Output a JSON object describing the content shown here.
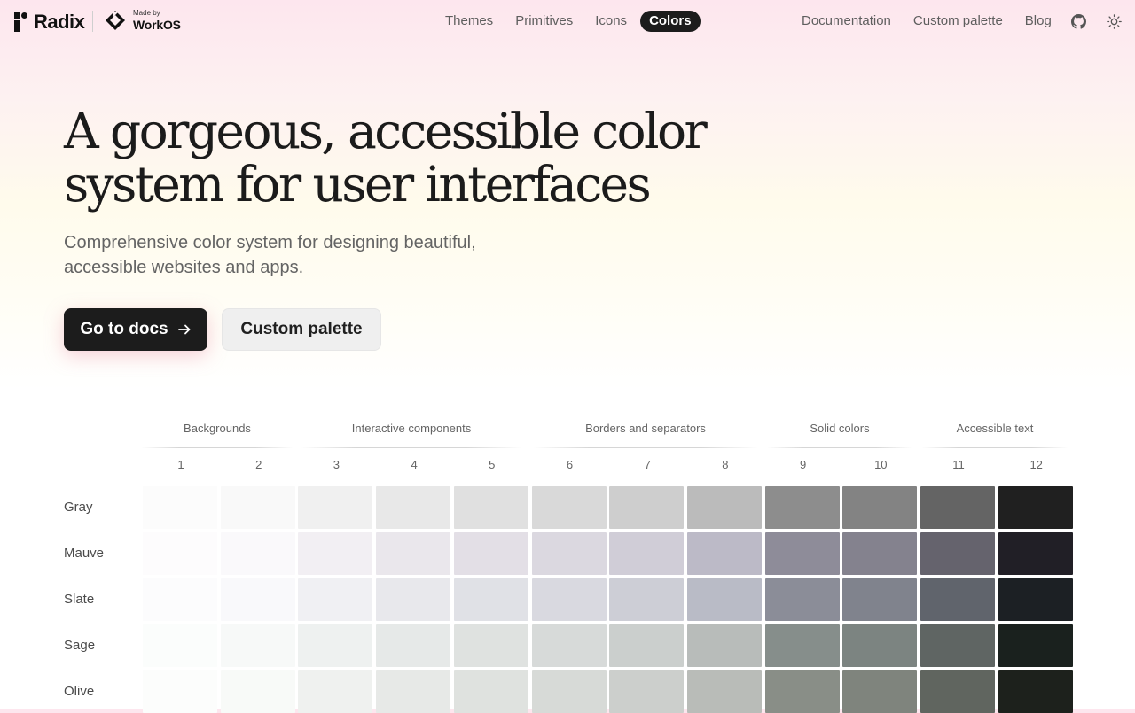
{
  "header": {
    "logo_text": "Radix",
    "made_by": "Made by",
    "workos_name": "WorkOS",
    "nav_center": [
      {
        "label": "Themes",
        "active": false
      },
      {
        "label": "Primitives",
        "active": false
      },
      {
        "label": "Icons",
        "active": false
      },
      {
        "label": "Colors",
        "active": true
      }
    ],
    "nav_right": [
      {
        "label": "Documentation"
      },
      {
        "label": "Custom palette"
      },
      {
        "label": "Blog"
      }
    ],
    "icons": {
      "github": "github-icon",
      "theme": "sun-icon"
    }
  },
  "hero": {
    "title_line1": "A gorgeous, accessible color",
    "title_line2": "system for user interfaces",
    "subtitle_line1": "Comprehensive color system for designing beautiful,",
    "subtitle_line2": "accessible websites and apps.",
    "primary_button": "Go to docs",
    "primary_button_icon": "arrow-right-icon",
    "secondary_button": "Custom palette"
  },
  "palette": {
    "groups": [
      "Backgrounds",
      "Interactive components",
      "Borders and separators",
      "Solid colors",
      "Accessible text"
    ],
    "steps": [
      "1",
      "2",
      "3",
      "4",
      "5",
      "6",
      "7",
      "8",
      "9",
      "10",
      "11",
      "12"
    ],
    "scales": [
      {
        "name": "Gray",
        "colors": [
          "#fcfcfc",
          "#f9f9f9",
          "#f0f0f0",
          "#e8e8e8",
          "#e0e0e0",
          "#d9d9d9",
          "#cecece",
          "#bbbbbb",
          "#8d8d8d",
          "#838383",
          "#646464",
          "#202020"
        ]
      },
      {
        "name": "Mauve",
        "colors": [
          "#fdfcfd",
          "#faf9fb",
          "#f2eff3",
          "#eae7ec",
          "#e3dfe6",
          "#dbd8e0",
          "#d0cdd7",
          "#bcbac7",
          "#8e8c99",
          "#84828e",
          "#65636d",
          "#211f26"
        ]
      },
      {
        "name": "Slate",
        "colors": [
          "#fcfcfd",
          "#f9f9fb",
          "#f0f0f3",
          "#e8e8ec",
          "#e0e1e6",
          "#d9d9e0",
          "#cdced6",
          "#b9bbc6",
          "#8b8d98",
          "#80838d",
          "#60646c",
          "#1c2024"
        ]
      },
      {
        "name": "Sage",
        "colors": [
          "#fbfdfc",
          "#f7f9f8",
          "#eef1f0",
          "#e6e9e8",
          "#dfe2e0",
          "#d7dad9",
          "#cbcfcd",
          "#b8bcba",
          "#868e8b",
          "#7c8481",
          "#5f6563",
          "#1a211e"
        ]
      },
      {
        "name": "Olive",
        "colors": [
          "#fcfdfc",
          "#f8faf8",
          "#eff1ef",
          "#e7e9e7",
          "#dfe2df",
          "#d7dad7",
          "#cccfcc",
          "#b9bcb8",
          "#898e87",
          "#7f847d",
          "#60655f",
          "#1d211c"
        ]
      }
    ]
  }
}
